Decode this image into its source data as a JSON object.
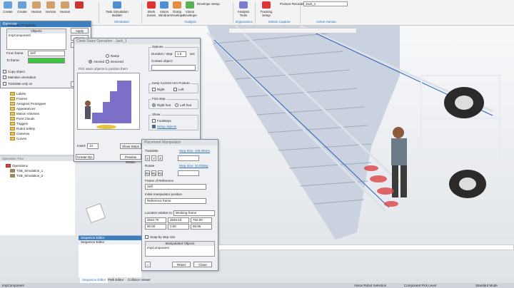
{
  "ribbon": {
    "left_buttons": [
      "Create",
      "Create",
      "Human",
      "Human",
      "Human"
    ],
    "sim_builder_label": "Task Simulation Builder",
    "work_zones": "Work Zones",
    "vision_window": "Vision Window",
    "grasp_envelope": "Grasp Envelope",
    "vision_envelope": "Vision Envelope",
    "envelope_setup": "Envelope Setup",
    "analysis_tools": "Analysis Tools",
    "tracking_setup": "Tracking Setup",
    "posture_recorder": "Posture Recorder",
    "posture_value": "Jack_1",
    "groups": [
      "Simulation",
      "Analysis",
      "Ergonomics",
      "Motion Capture",
      "Active Human"
    ]
  },
  "relocate": {
    "title": "Relocate",
    "section": "Relocate Properties",
    "objects_header": "Objects",
    "object_value": "ImpComponent",
    "from_frame_label": "From frame:",
    "from_frame_value": "Self",
    "to_frame_label": "To frame:",
    "copy_object": "Copy object",
    "maintain_orientation": "Maintain orientation",
    "translate_only_on": "Translate only on",
    "apply": "Apply",
    "reset": "Reset",
    "close": "Close",
    "flip": "Flip"
  },
  "tree": {
    "items": [
      "Labels",
      "Frames",
      "Assigned Prototypes",
      "Appearances",
      "Motion Volumes",
      "Point Clouds",
      "Triggers",
      "Robot Safety",
      "Cameras",
      "Curves"
    ],
    "ops_header": "Operation Tree",
    "ops": [
      "Operations",
      "TSB_Simulation_1",
      "TSB_Simulation_2"
    ]
  },
  "stairs": {
    "title": "Climb Stairs Operation - Jack_1",
    "ramp": "Ramp",
    "ascend": "Ascend",
    "descend": "Descend",
    "hint": "Pick stairs objects to position them",
    "options": "Options",
    "duration_label": "Duration / step:",
    "duration_value": "1.5",
    "duration_unit": "sec",
    "contact_object": "Contact object:",
    "keep_arm_posture": "Keep Current Arm Posture",
    "right": "Right",
    "left": "Left",
    "first_step": "First step",
    "right_foot": "Right foot",
    "left_foot": "Left foot",
    "show": "Show",
    "footsteps": "Footsteps",
    "setup_objects": "Setup objects",
    "insert_label": "Insert:",
    "insert_value": "13",
    "show_steps": "Show Steps",
    "create_op": "Create Op.",
    "preview_motion": "Preview Motion"
  },
  "placement": {
    "title": "Placement Manipulator",
    "translate": "Translate",
    "step_size_t": "Step Size: 100.00mm",
    "rotate": "Rotate",
    "step_size_r": "Step Size: 10.00deg",
    "frame_of_reference": "Frame of Reference",
    "frame_value": "Self",
    "initial_position": "Initial manipulator position",
    "ref_frame": "Reference frame",
    "location_relative": "Location relative to:",
    "working_frame": "Working frame",
    "xyz": [
      "2534.70",
      "3945.63",
      "750.00"
    ],
    "rxyz": [
      "90.00",
      "0.00",
      "89.96"
    ],
    "snap": "Snap by step size",
    "manipulated_objects": "Manipulated Objects",
    "manip_value": "ImpComponent",
    "reset": "Reset",
    "close": "Close"
  },
  "sequence": {
    "header": "Sequence Editor",
    "tab_label": "Sequence Editor"
  },
  "bottom_tabs": [
    "Sequence Editor",
    "Path Editor",
    "Collision Viewer"
  ],
  "status": {
    "left": "ImpComponent",
    "mid1": "Vision Robot Selection",
    "mid2": "Component Pick Level",
    "right": "Standard Mode"
  },
  "colors": {
    "accent": "#3c7fc1",
    "stair": "#b6c2d2",
    "rail": "#d8dde4"
  }
}
